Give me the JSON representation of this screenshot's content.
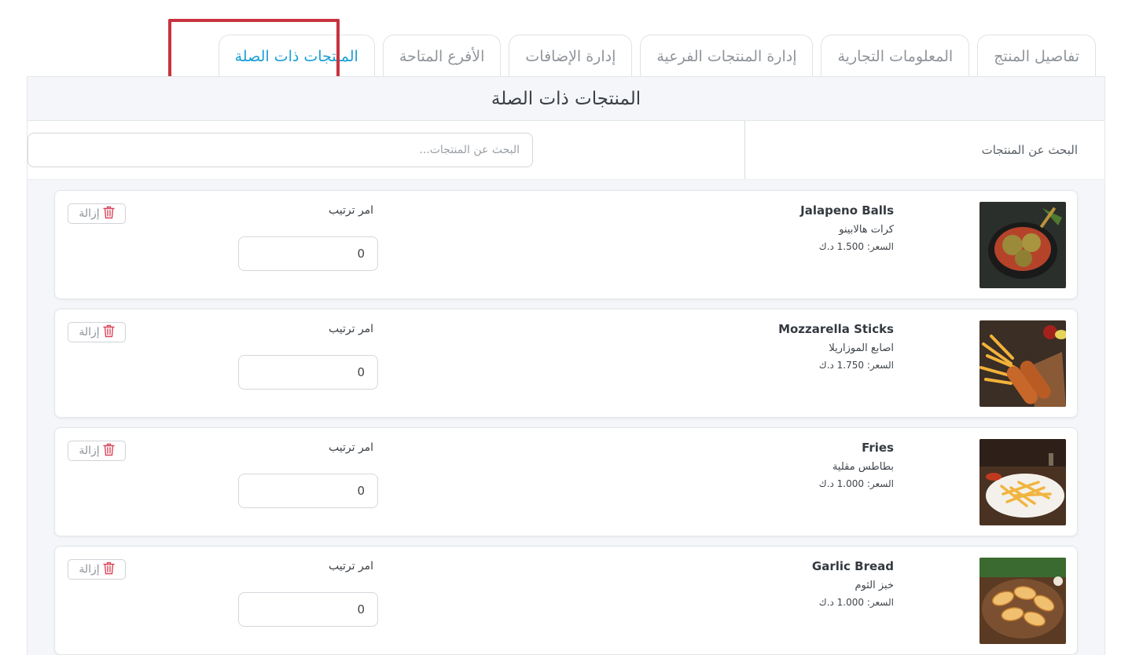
{
  "tabs": [
    {
      "label": "تفاصيل المنتج",
      "active": false
    },
    {
      "label": "المعلومات التجارية",
      "active": false
    },
    {
      "label": "إدارة المنتجات الفرعية",
      "active": false
    },
    {
      "label": "إدارة الإضافات",
      "active": false
    },
    {
      "label": "الأفرع المتاحة",
      "active": false
    },
    {
      "label": "المنتجات ذات الصلة",
      "active": true
    }
  ],
  "panel": {
    "title": "المنتجات ذات الصلة",
    "search_label": "البحث عن المنتجات",
    "search_placeholder": "البحث عن المنتجات...",
    "search_value": ""
  },
  "colors": {
    "active_tab": "#1a9fd6",
    "highlight_border": "#c8323f",
    "trash_icon": "#d9475b"
  },
  "products": [
    {
      "name_en": "Jalapeno Balls",
      "name_ar": "كرات هالابينو",
      "price": "السعر: 1.500 د.ك",
      "order_label": "امر ترتيب",
      "order_value": "0",
      "remove_label": "إزالة",
      "image": "jalapeno-balls-photo"
    },
    {
      "name_en": "Mozzarella Sticks",
      "name_ar": "اصابع الموزاريلا",
      "price": "السعر: 1.750 د.ك",
      "order_label": "امر ترتيب",
      "order_value": "0",
      "remove_label": "إزالة",
      "image": "mozzarella-sticks-photo"
    },
    {
      "name_en": "Fries",
      "name_ar": "بطاطس مقلية",
      "price": "السعر: 1.000 د.ك",
      "order_label": "امر ترتيب",
      "order_value": "0",
      "remove_label": "إزالة",
      "image": "fries-photo"
    },
    {
      "name_en": "Garlic Bread",
      "name_ar": "خبز الثوم",
      "price": "السعر: 1.000 د.ك",
      "order_label": "امر ترتيب",
      "order_value": "0",
      "remove_label": "إزالة",
      "image": "garlic-bread-photo"
    }
  ]
}
